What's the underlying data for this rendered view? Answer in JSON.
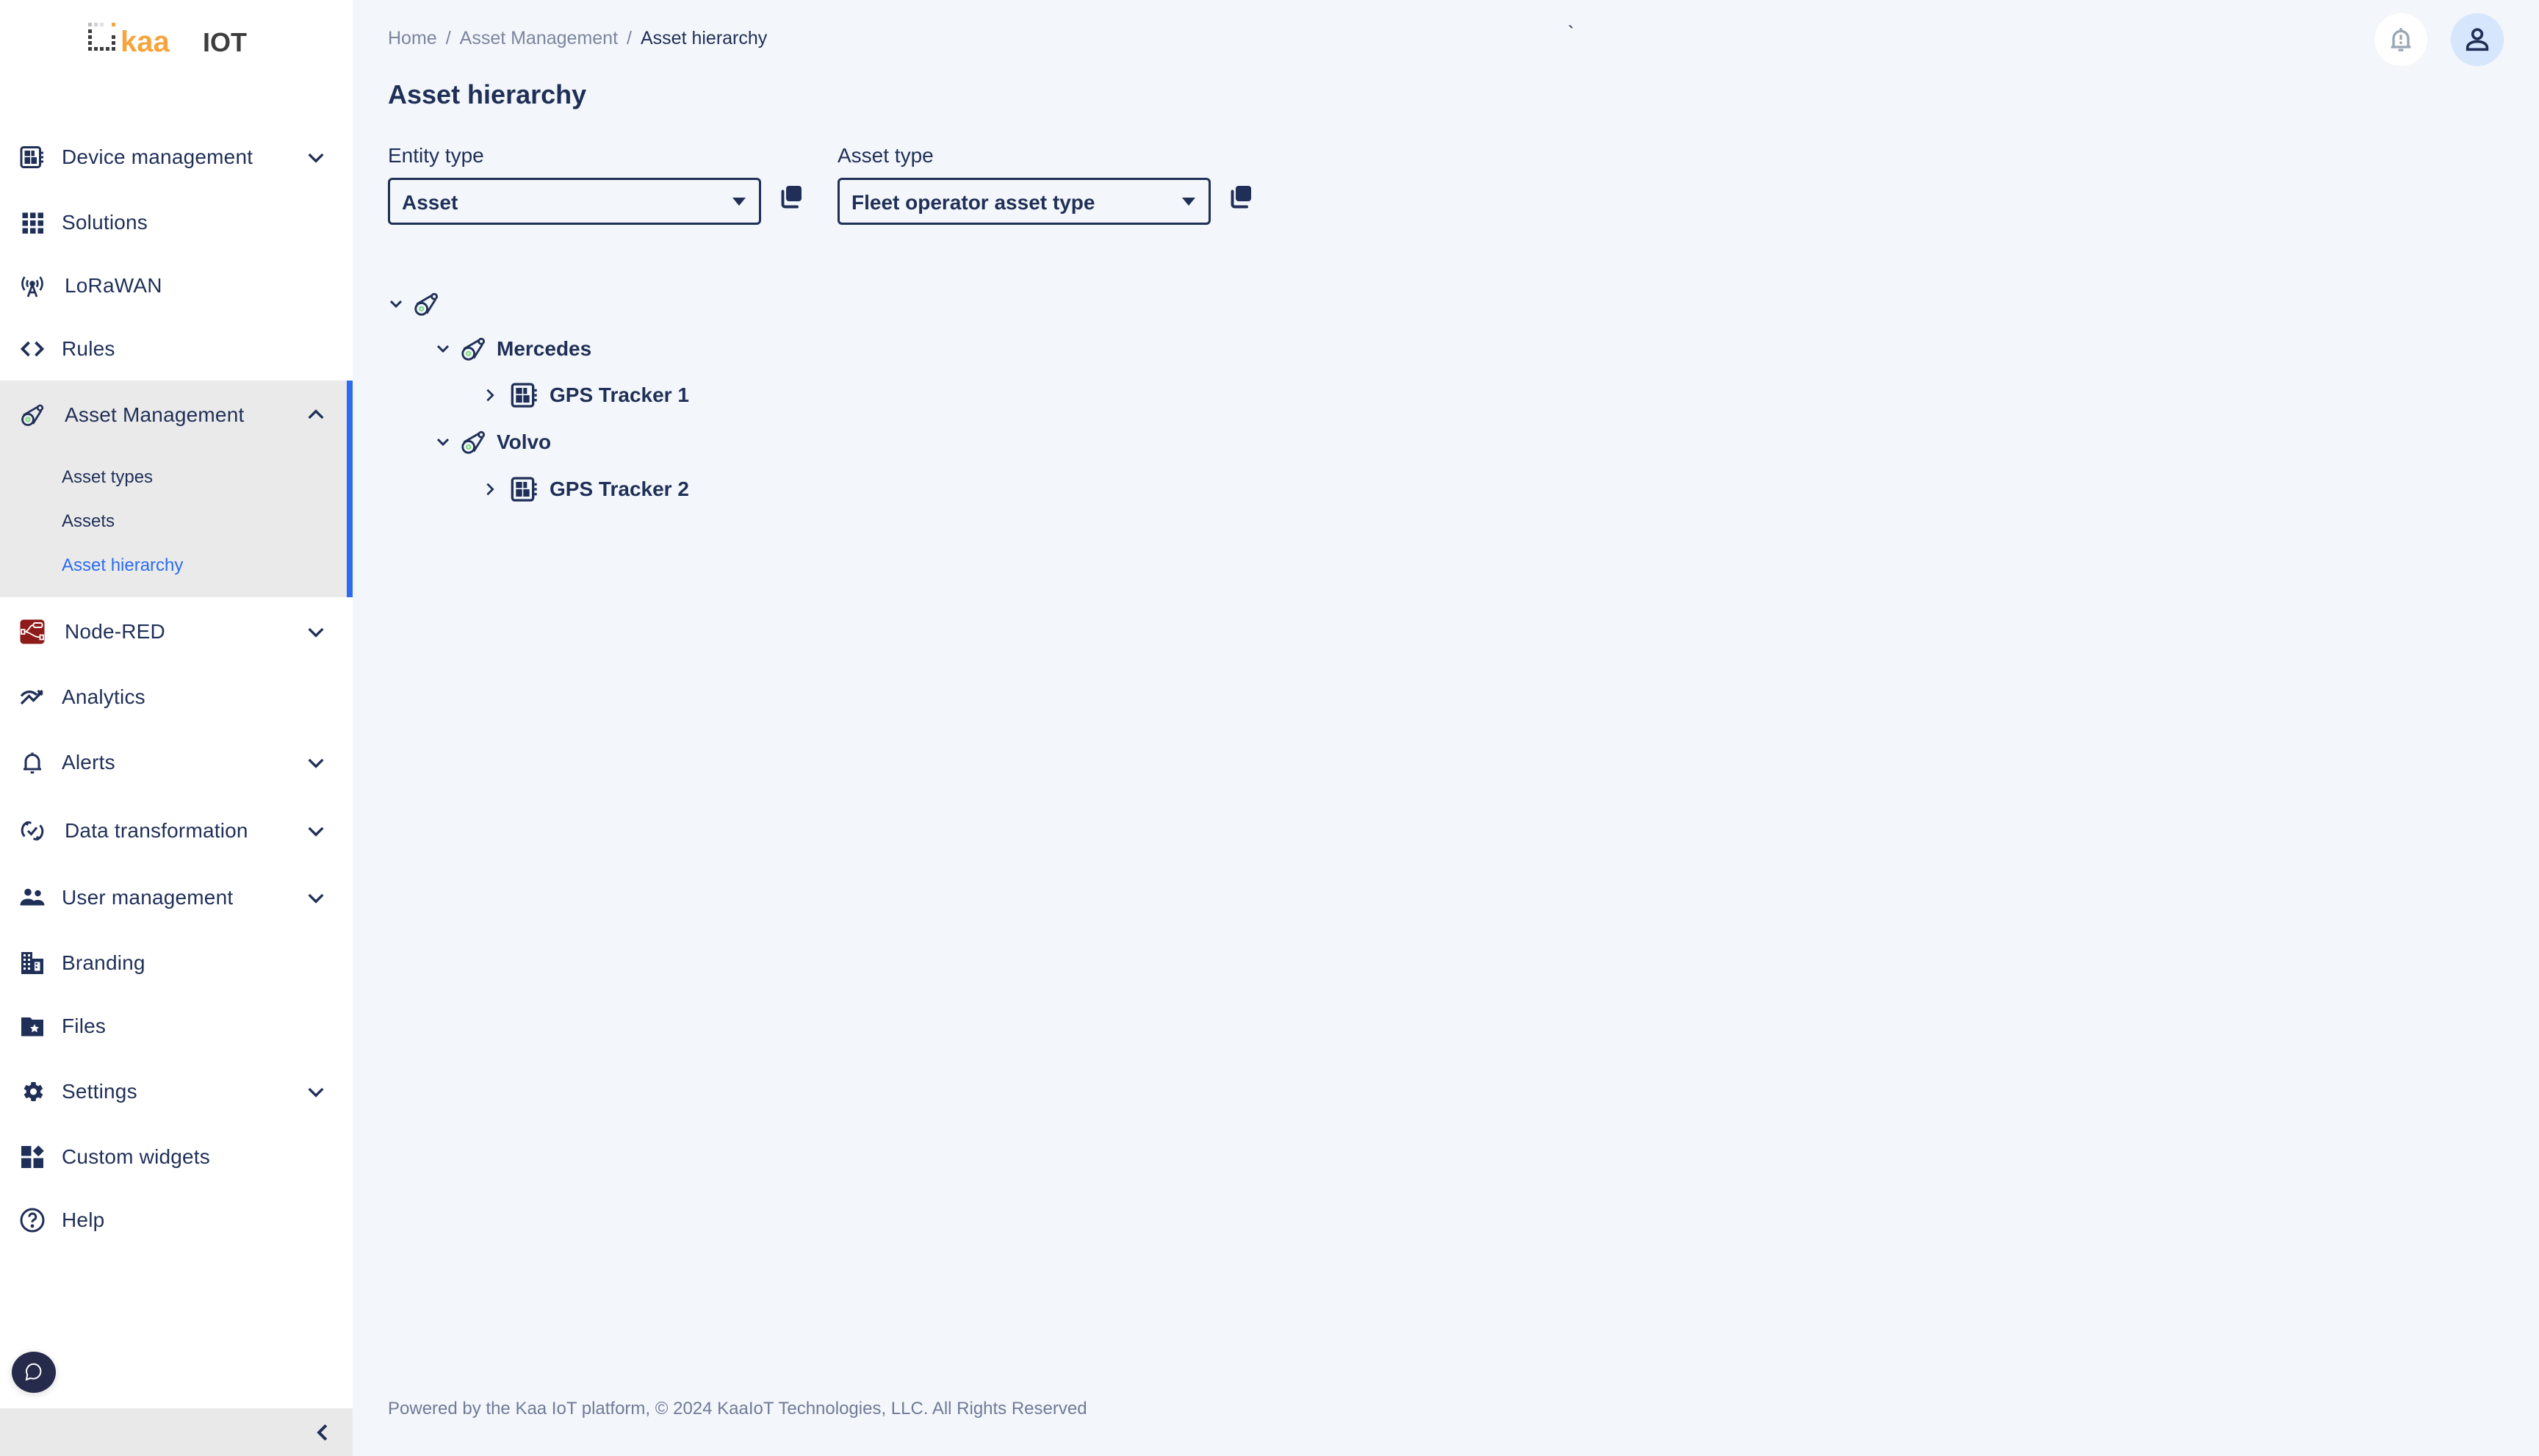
{
  "app": {
    "logo_text_left": "kaa",
    "logo_text_right": "IOT",
    "colors": {
      "primary_text": "#1f2f57",
      "accent": "#2c6cf0",
      "logo_orange": "#f5a53c",
      "logo_gray": "#3d3d3d",
      "nodered": "#8f1a1a",
      "asset_icon_dot": "#7ddc7d",
      "main_bg": "#f3f6fa",
      "sidebar_active_bg": "#eaeaea"
    }
  },
  "sidebar": {
    "items": [
      {
        "label": "Device management",
        "icon": "device-icon",
        "expandable": true
      },
      {
        "label": "Solutions",
        "icon": "grid-icon",
        "expandable": false
      },
      {
        "label": "LoRaWAN",
        "icon": "antenna-icon",
        "expandable": false
      },
      {
        "label": "Rules",
        "icon": "code-icon",
        "expandable": false
      },
      {
        "label": "Asset Management",
        "icon": "asset-icon",
        "expandable": true,
        "expanded": true,
        "children": [
          {
            "label": "Asset types"
          },
          {
            "label": "Assets"
          },
          {
            "label": "Asset hierarchy",
            "current": true
          }
        ]
      },
      {
        "label": "Node-RED",
        "icon": "nodered-icon",
        "expandable": true
      },
      {
        "label": "Analytics",
        "icon": "analytics-icon",
        "expandable": false
      },
      {
        "label": "Alerts",
        "icon": "bell-icon",
        "expandable": true
      },
      {
        "label": "Data transformation",
        "icon": "sync-check-icon",
        "expandable": true
      },
      {
        "label": "User management",
        "icon": "users-icon",
        "expandable": true
      },
      {
        "label": "Branding",
        "icon": "building-icon",
        "expandable": false
      },
      {
        "label": "Files",
        "icon": "folder-star-icon",
        "expandable": false
      },
      {
        "label": "Settings",
        "icon": "gear-icon",
        "expandable": true
      },
      {
        "label": "Custom widgets",
        "icon": "widgets-icon",
        "expandable": false
      },
      {
        "label": "Help",
        "icon": "help-icon",
        "expandable": false
      }
    ],
    "chat_icon": "chat-bubble-icon",
    "collapse_icon": "chevron-left-icon"
  },
  "header": {
    "breadcrumb": [
      {
        "label": "Home"
      },
      {
        "label": "Asset Management"
      },
      {
        "label": "Asset hierarchy",
        "current": true
      }
    ],
    "separator": "/",
    "stray_text": "`",
    "notification_icon": "bell-alert-icon",
    "user_icon": "user-icon"
  },
  "main": {
    "title": "Asset hierarchy",
    "entity_type": {
      "label": "Entity type",
      "value": "Asset"
    },
    "asset_type": {
      "label": "Asset type",
      "value": "Fleet operator asset type"
    },
    "tree": [
      {
        "label": "",
        "type": "asset",
        "expanded": true,
        "level": 0
      },
      {
        "label": "Mercedes",
        "type": "asset",
        "expanded": true,
        "level": 1
      },
      {
        "label": "GPS Tracker 1",
        "type": "device",
        "expanded": false,
        "level": 2
      },
      {
        "label": "Volvo",
        "type": "asset",
        "expanded": true,
        "level": 1
      },
      {
        "label": "GPS Tracker 2",
        "type": "device",
        "expanded": false,
        "level": 2
      }
    ]
  },
  "footer": {
    "text": "Powered by the Kaa IoT platform, © 2024 KaaIoT Technologies, LLC. All Rights Reserved"
  }
}
